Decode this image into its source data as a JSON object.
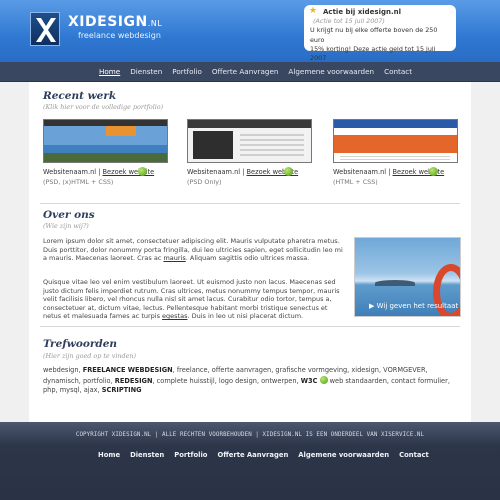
{
  "header": {
    "logo_name": "XIDESIGN",
    "logo_tld": ".NL",
    "tagline": "freelance webdesign",
    "promo": {
      "title": "Actie bij xidesign.nl",
      "date": "(Actie tot 15 juli 2007)",
      "line1": "U krijgt nu bij elke offerte boven de 250 euro",
      "line2": "15% korting! Deze actie geld tot 15 juli 2007",
      "star_color": "#f2b41a"
    }
  },
  "nav": {
    "items": [
      "Home",
      "Diensten",
      "Portfolio",
      "Offerte Aanvragen",
      "Algemene voorwaarden",
      "Contact"
    ]
  },
  "recent": {
    "title": "Recent werk",
    "subtitle": "(Klik hier voor de volledige portfolio)",
    "items": [
      {
        "name": "Websitenaam.nl",
        "separator": "|",
        "link": "Bezoek website",
        "tech": "(PSD, (x)HTML + CSS)"
      },
      {
        "name": "Websitenaam.nl",
        "separator": "|",
        "link": "Bezoek website",
        "tech": "(PSD Only)"
      },
      {
        "name": "Websitenaam.nl",
        "separator": "|",
        "link": "Bezoek website",
        "tech": "(HTML + CSS)"
      }
    ]
  },
  "about": {
    "title": "Over ons",
    "subtitle": "(Wie zijn wij?)",
    "p1_a": "Lorem ipsum dolor sit amet, consectetuer adipiscing elit. Mauris vulputate pharetra metus. Duis porttitor, dolor nonummy porta fringilla, dui leo ultricies sapien, eget sollicitudin leo mi a mauris. Maecenas laoreet. Cras ac ",
    "p1_link": "mauris",
    "p1_b": ". Aliquam sagittis odio ultrices massa.",
    "p2_a": "Quisque vitae leo vel enim vestibulum laoreet. Ut euismod justo non lacus. Maecenas sed justo dictum felis imperdiet rutrum. Cras ultrices, metus nonummy tempus tempor, mauris velit facilisis libero, vel rhoncus nulla nisl sit amet lacus. Curabitur odio tortor, tempus a, consectetuer at, dictum vitae, lectus. Pellentesque habitant morbi tristique senectus et netus et malesuada fames ac turpis ",
    "p2_link": "egestas",
    "p2_b": ". Duis in leo ut nisi placerat dictum.",
    "photo_caption": "▶ Wij geven het resultaat"
  },
  "tags": {
    "title": "Trefwoorden",
    "subtitle": "(Hier zijn goed op te vinden)",
    "t1": "webdesign, ",
    "b1": "FREELANCE WEBDESIGN",
    "t2": ", freelance, offerte aanvragen, grafische vormgeving, xidesign, VORMGEVER, dynamisch, portfolio, ",
    "b2": "REDESIGN",
    "t3": ", complete huisstijl, logo design, ontwerpen, ",
    "b3": "W3C",
    "t4": " web standaarden, contact formulier, php, mysql, ajax, ",
    "b4": "SCRIPTING"
  },
  "footer": {
    "copyright": "COPYRIGHT XIDESIGN.NL | ALLE RECHTEN VOORBEHOUDEN | XIDESIGN.NL IS EEN ONDERDEEL VAN XISERVICE.NL",
    "nav": [
      "Home",
      "Diensten",
      "Portfolio",
      "Offerte Aanvragen",
      "Algemene voorwaarden",
      "Contact"
    ]
  }
}
